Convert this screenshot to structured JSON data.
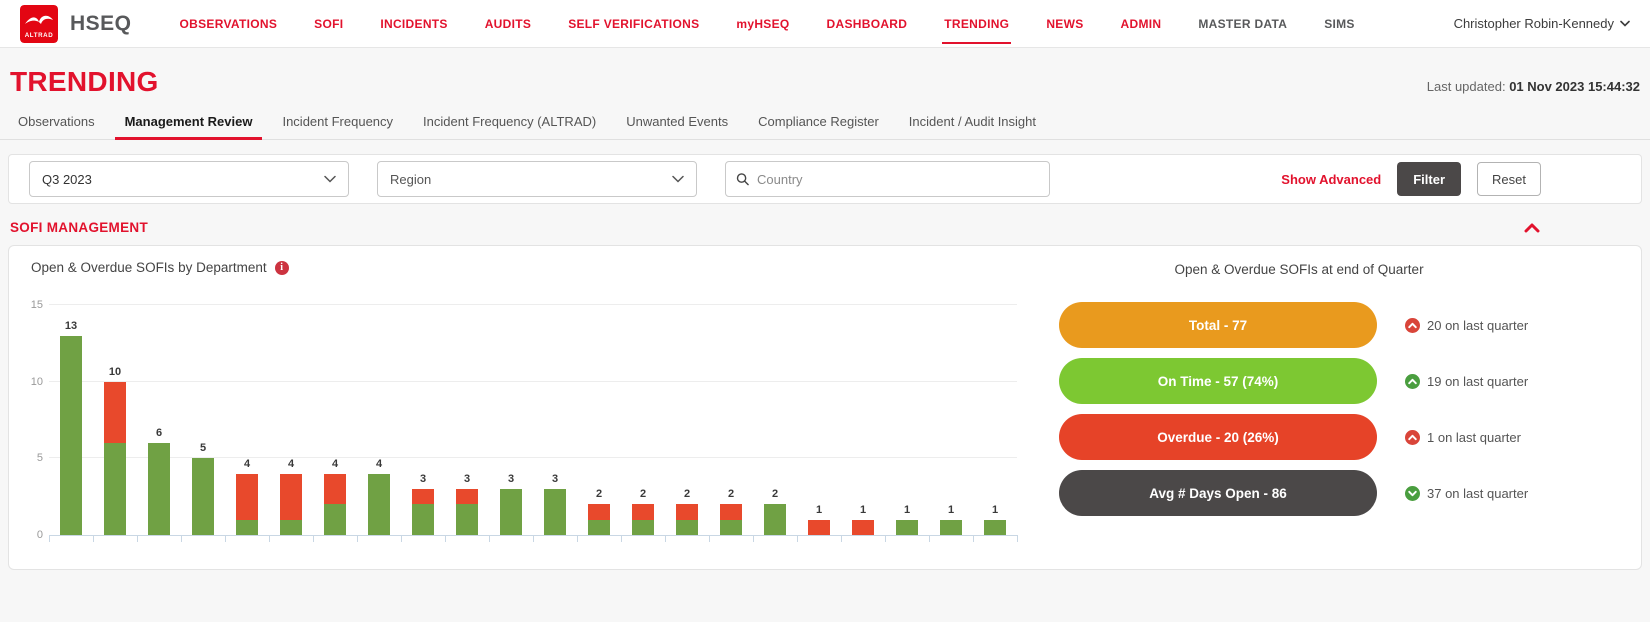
{
  "brand": {
    "logo_text": "ALTRAD",
    "app_name": "HSEQ"
  },
  "nav": {
    "items": [
      {
        "label": "OBSERVATIONS"
      },
      {
        "label": "SOFI"
      },
      {
        "label": "INCIDENTS"
      },
      {
        "label": "AUDITS"
      },
      {
        "label": "SELF VERIFICATIONS"
      },
      {
        "label": "myHSEQ"
      },
      {
        "label": "DASHBOARD"
      },
      {
        "label": "TRENDING",
        "active": true
      },
      {
        "label": "NEWS"
      },
      {
        "label": "ADMIN"
      },
      {
        "label": "MASTER DATA",
        "muted": true
      },
      {
        "label": "SIMS",
        "muted": true
      }
    ],
    "user_name": "Christopher Robin-Kennedy"
  },
  "page": {
    "title": "TRENDING",
    "last_updated_label": "Last updated:",
    "last_updated_value": "01 Nov 2023 15:44:32"
  },
  "tabs": [
    {
      "label": "Observations"
    },
    {
      "label": "Management Review",
      "active": true
    },
    {
      "label": "Incident Frequency"
    },
    {
      "label": "Incident Frequency (ALTRAD)"
    },
    {
      "label": "Unwanted Events"
    },
    {
      "label": "Compliance Register"
    },
    {
      "label": "Incident / Audit Insight"
    }
  ],
  "filters": {
    "quarter_value": "Q3 2023",
    "region_placeholder": "Region",
    "country_placeholder": "Country",
    "show_advanced_label": "Show Advanced",
    "filter_label": "Filter",
    "reset_label": "Reset"
  },
  "section": {
    "title": "SOFI MANAGEMENT"
  },
  "chart_data": {
    "type": "bar",
    "stacked": true,
    "title": "Open & Overdue SOFIs by Department",
    "x_category_labels_visible": false,
    "series": [
      {
        "name": "On Time",
        "color": "#70a144",
        "values": [
          13,
          6,
          6,
          5,
          1,
          1,
          2,
          4,
          2,
          2,
          3,
          3,
          1,
          1,
          1,
          1,
          2,
          0,
          0,
          1,
          1,
          1
        ]
      },
      {
        "name": "Overdue",
        "color": "#e8492c",
        "values": [
          0,
          4,
          0,
          0,
          3,
          3,
          2,
          0,
          1,
          1,
          0,
          0,
          1,
          1,
          1,
          1,
          0,
          1,
          1,
          0,
          0,
          0
        ]
      }
    ],
    "totals": [
      13,
      10,
      6,
      5,
      4,
      4,
      4,
      4,
      3,
      3,
      3,
      3,
      2,
      2,
      2,
      2,
      2,
      1,
      1,
      1,
      1,
      1
    ],
    "ylim": [
      0,
      15
    ],
    "yticks": [
      0,
      5,
      10,
      15
    ],
    "grid": true,
    "legend": "none"
  },
  "stats": {
    "title": "Open & Overdue SOFIs at end of Quarter",
    "pills": [
      {
        "label": "Total - 77",
        "color": "#e99a1e",
        "delta_text": "20 on last quarter",
        "delta_dir": "up",
        "delta_color": "#d9453a"
      },
      {
        "label": "On Time - 57 (74%)",
        "color": "#7dc832",
        "delta_text": "19 on last quarter",
        "delta_dir": "up",
        "delta_color": "#4a9e3f"
      },
      {
        "label": "Overdue - 20 (26%)",
        "color": "#e64328",
        "delta_text": "1 on last quarter",
        "delta_dir": "up",
        "delta_color": "#d9453a"
      },
      {
        "label": "Avg # Days Open - 86",
        "color": "#4b4848",
        "delta_text": "37 on last quarter",
        "delta_dir": "down",
        "delta_color": "#4a9e3f"
      }
    ]
  }
}
